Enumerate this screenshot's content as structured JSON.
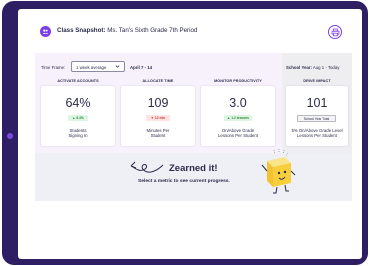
{
  "header": {
    "title_label": "Class Snapshot:",
    "class_name": "Ms. Tan's Sixth Grade 7th Period"
  },
  "filters": {
    "time_frame_label": "Time Frame:",
    "time_frame_value": "1 week average",
    "date_range": "April 7 - 14",
    "school_year_label": "School Year:",
    "school_year_range": "Aug 1 - Today"
  },
  "metrics": [
    {
      "title": "ACTIVATE ACCOUNTS",
      "value": "64%",
      "change": "6.3%",
      "direction": "up",
      "label_line1": "Students",
      "label_line2": "Signing In"
    },
    {
      "title": "ALLOCATE TIME",
      "value": "109",
      "change": "12 min",
      "direction": "down",
      "label_line1": "Minutes Per",
      "label_line2": "Student"
    },
    {
      "title": "MONITOR PRODUCTIVITY",
      "value": "3.0",
      "change": "1.2 lessons",
      "direction": "up",
      "label_line1": "On/Above Grade",
      "label_line2": "Lessons Per Student"
    }
  ],
  "drive_impact": {
    "title": "DRIVE IMPACT",
    "value": "101",
    "badge": "School Year Total",
    "label_line1": "5% On/Above Grade Level",
    "label_line2": "Lessons Per Student"
  },
  "empty_state": {
    "heading": "Zearned it!",
    "instruction": "Select a metric to see current progress."
  },
  "colors": {
    "frame": "#2e1e63",
    "accent": "#7b3fe4",
    "main_panel_bg": "#f6f1fb",
    "side_panel_bg": "#eeeef1",
    "positive": "#2a8a3c",
    "negative": "#d23b33",
    "mascot": "#f7cf3c"
  },
  "icons": [
    "class-icon",
    "print-icon",
    "chevron-down-icon",
    "arrow-up-icon",
    "arrow-down-icon",
    "swirl-arrow-icon",
    "mascot-icon"
  ]
}
